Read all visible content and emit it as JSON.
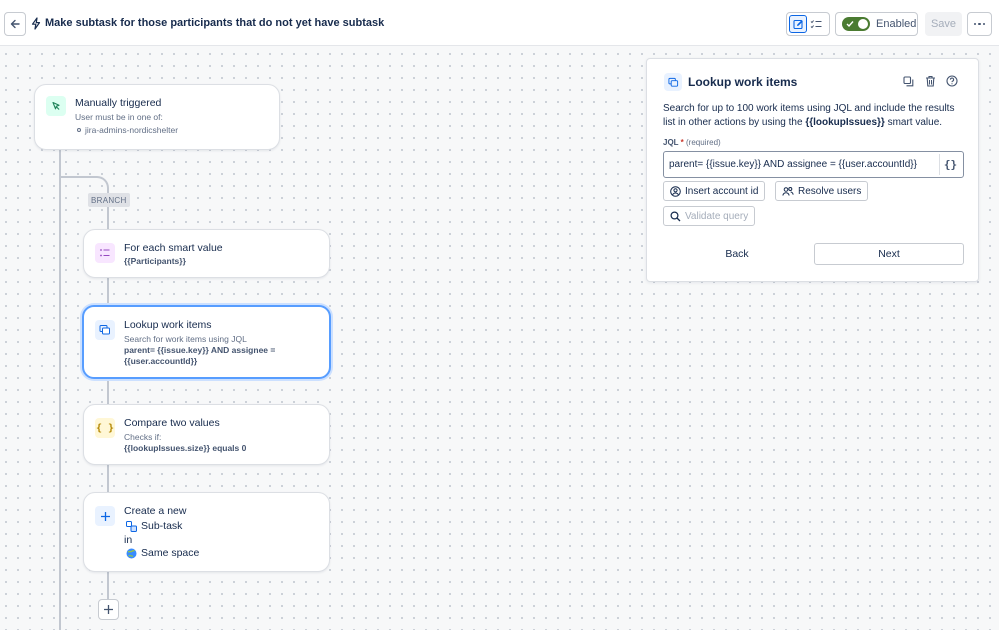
{
  "header": {
    "title": "Make subtask for those participants that do not yet have subtask",
    "toggle_label": "Enabled",
    "save_label": "Save"
  },
  "flow": {
    "trigger": {
      "title": "Manually triggered",
      "subtitle": "User must be in one of:",
      "groups": [
        "jira-admins-nordicshelter"
      ]
    },
    "branch_label": "BRANCH",
    "steps": [
      {
        "title": "For each smart value",
        "lines": [
          "{{Participants}}"
        ]
      },
      {
        "title": "Lookup work items",
        "subtitle": "Search for work items using JQL",
        "lines": [
          "parent= {{issue.key}} AND assignee =",
          "{{user.accountId}}"
        ]
      },
      {
        "title": "Compare two values",
        "subtitle": "Checks if:",
        "lines": [
          "{{lookupIssues.size}} equals 0"
        ]
      },
      {
        "title": "Create a new",
        "issue_type": "Sub-task",
        "connector": "in",
        "space": "Same space"
      }
    ]
  },
  "panel": {
    "title": "Lookup work items",
    "description_pre": "Search for up to 100 work items using JQL and include the results list in other actions by using the ",
    "description_token": "{{lookupIssues}}",
    "description_post": " smart value.",
    "jql_label": "JQL",
    "jql_required_mark": "*",
    "jql_hint": "(required)",
    "jql_value": "parent= {{issue.key}} AND assignee = {{user.accountId}}",
    "brace_label": "{}",
    "insert_account_label": "Insert account id",
    "resolve_users_label": "Resolve users",
    "validate_label": "Validate query",
    "back_label": "Back",
    "next_label": "Next"
  },
  "colors": {
    "accent": "#0c66e4",
    "toggle_on": "#4a7b31",
    "trigger_icon_bg": "#dcfff1",
    "foreach_icon_bg": "#f8e6ff",
    "lookup_icon_bg": "#e9f2ff",
    "compare_icon_bg": "#fff7d6",
    "create_icon_bg": "#e9f2ff"
  }
}
